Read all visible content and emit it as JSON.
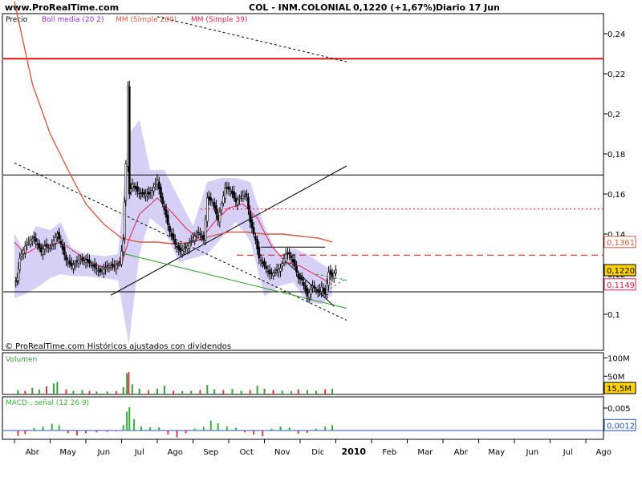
{
  "header": {
    "site": "www.ProRealTime.com",
    "title": "COL - INM.COLONIAL",
    "price_change": "0,1220 (+1,67%)",
    "period": "Diario",
    "date": "17 Jun"
  },
  "footer": {
    "source_note": "© ProRealTime.com  Históricos ajustados con dividendos"
  },
  "colors": {
    "price": "#000000",
    "bollinger": "#c8c0f4",
    "bollinger_label": "#9a2ee0",
    "ma200": "#d95a45",
    "ma39": "#e02050",
    "support_red": "#e01010",
    "volume": "#3a9c3a",
    "macd": "#38b038",
    "signal": "#2050d0",
    "axis_text": "#000000"
  },
  "chart_data": [
    {
      "type": "line",
      "panel": "price",
      "legend": [
        "Precio",
        "Boll media (20 2)",
        "MM (Simple 200)",
        "MM (Simple 39)"
      ],
      "months": [
        "Abr",
        "May",
        "Jun",
        "Jul",
        "Ago",
        "Sep",
        "Oct",
        "Nov",
        "Dic",
        "2010",
        "Feb",
        "Mar",
        "Abr",
        "May",
        "Jun",
        "Jul",
        "Ago"
      ],
      "y_ticks": [
        0.1,
        0.12,
        0.14,
        0.16,
        0.18,
        0.2,
        0.22,
        0.24
      ],
      "y_tick_labels": [
        "0,1",
        "0,12",
        "0,14",
        "0,16",
        "0,18",
        "0,2",
        "0,22",
        "0,24"
      ],
      "ylim": [
        0.082,
        0.25
      ],
      "price_labels": [
        {
          "text": "0,1361",
          "value": 0.1361,
          "color": "#d95a45"
        },
        {
          "text": "0,1220",
          "value": 0.122,
          "color": "#000000",
          "highlight": true
        },
        {
          "text": "0,1149",
          "value": 0.1149,
          "color": "#e02050"
        }
      ],
      "horizontal_levels": [
        {
          "value": 0.2275,
          "color": "#e01010",
          "style": "solid"
        },
        {
          "value": 0.1695,
          "color": "#000000",
          "style": "solid"
        },
        {
          "value": 0.1112,
          "color": "#000000",
          "style": "solid"
        },
        {
          "value": 0.1295,
          "color": "#e01010",
          "style": "dashed"
        },
        {
          "value": 0.1525,
          "color": "#e01010",
          "style": "dotted"
        }
      ],
      "close_points": [
        {
          "t": 0.0,
          "v": 0.115
        },
        {
          "t": 0.08,
          "v": 0.118
        },
        {
          "t": 0.15,
          "v": 0.128
        },
        {
          "t": 0.3,
          "v": 0.134
        },
        {
          "t": 0.45,
          "v": 0.137
        },
        {
          "t": 0.55,
          "v": 0.138
        },
        {
          "t": 0.75,
          "v": 0.131
        },
        {
          "t": 0.85,
          "v": 0.134
        },
        {
          "t": 1.0,
          "v": 0.133
        },
        {
          "t": 1.2,
          "v": 0.14
        },
        {
          "t": 1.3,
          "v": 0.135
        },
        {
          "t": 1.45,
          "v": 0.127
        },
        {
          "t": 1.6,
          "v": 0.124
        },
        {
          "t": 1.8,
          "v": 0.127
        },
        {
          "t": 2.0,
          "v": 0.127
        },
        {
          "t": 2.2,
          "v": 0.124
        },
        {
          "t": 2.4,
          "v": 0.121
        },
        {
          "t": 2.6,
          "v": 0.124
        },
        {
          "t": 2.8,
          "v": 0.124
        },
        {
          "t": 2.95,
          "v": 0.126
        },
        {
          "t": 3.05,
          "v": 0.137
        },
        {
          "t": 3.12,
          "v": 0.175
        },
        {
          "t": 3.18,
          "v": 0.214
        },
        {
          "t": 3.22,
          "v": 0.16
        },
        {
          "t": 3.3,
          "v": 0.165
        },
        {
          "t": 3.5,
          "v": 0.16
        },
        {
          "t": 3.8,
          "v": 0.16
        },
        {
          "t": 4.0,
          "v": 0.167
        },
        {
          "t": 4.1,
          "v": 0.158
        },
        {
          "t": 4.2,
          "v": 0.152
        },
        {
          "t": 4.35,
          "v": 0.141
        },
        {
          "t": 4.5,
          "v": 0.135
        },
        {
          "t": 4.65,
          "v": 0.131
        },
        {
          "t": 4.85,
          "v": 0.134
        },
        {
          "t": 5.0,
          "v": 0.138
        },
        {
          "t": 5.15,
          "v": 0.141
        },
        {
          "t": 5.3,
          "v": 0.137
        },
        {
          "t": 5.4,
          "v": 0.158
        },
        {
          "t": 5.55,
          "v": 0.156
        },
        {
          "t": 5.7,
          "v": 0.147
        },
        {
          "t": 5.9,
          "v": 0.163
        },
        {
          "t": 6.05,
          "v": 0.162
        },
        {
          "t": 6.2,
          "v": 0.156
        },
        {
          "t": 6.35,
          "v": 0.159
        },
        {
          "t": 6.5,
          "v": 0.159
        },
        {
          "t": 6.6,
          "v": 0.146
        },
        {
          "t": 6.75,
          "v": 0.137
        },
        {
          "t": 6.85,
          "v": 0.128
        },
        {
          "t": 7.0,
          "v": 0.124
        },
        {
          "t": 7.15,
          "v": 0.12
        },
        {
          "t": 7.3,
          "v": 0.121
        },
        {
          "t": 7.45,
          "v": 0.123
        },
        {
          "t": 7.6,
          "v": 0.13
        },
        {
          "t": 7.7,
          "v": 0.13
        },
        {
          "t": 7.85,
          "v": 0.124
        },
        {
          "t": 7.95,
          "v": 0.118
        },
        {
          "t": 8.05,
          "v": 0.117
        },
        {
          "t": 8.2,
          "v": 0.109
        },
        {
          "t": 8.35,
          "v": 0.114
        },
        {
          "t": 8.5,
          "v": 0.111
        },
        {
          "t": 8.6,
          "v": 0.1135
        },
        {
          "t": 8.7,
          "v": 0.11
        },
        {
          "t": 8.8,
          "v": 0.121
        },
        {
          "t": 8.9,
          "v": 0.119
        },
        {
          "t": 9.0,
          "v": 0.122
        }
      ],
      "ma200_points": [
        {
          "t": 0.0,
          "v": 0.256
        },
        {
          "t": 0.5,
          "v": 0.215
        },
        {
          "t": 1.0,
          "v": 0.19
        },
        {
          "t": 1.5,
          "v": 0.172
        },
        {
          "t": 2.0,
          "v": 0.155
        },
        {
          "t": 2.5,
          "v": 0.145
        },
        {
          "t": 3.0,
          "v": 0.138
        },
        {
          "t": 3.5,
          "v": 0.136
        },
        {
          "t": 4.0,
          "v": 0.136
        },
        {
          "t": 4.5,
          "v": 0.135
        },
        {
          "t": 5.0,
          "v": 0.136
        },
        {
          "t": 5.5,
          "v": 0.139
        },
        {
          "t": 6.0,
          "v": 0.141
        },
        {
          "t": 6.5,
          "v": 0.141
        },
        {
          "t": 7.0,
          "v": 0.14
        },
        {
          "t": 7.5,
          "v": 0.14
        },
        {
          "t": 8.0,
          "v": 0.139
        },
        {
          "t": 8.5,
          "v": 0.138
        },
        {
          "t": 8.9,
          "v": 0.1361
        }
      ],
      "ma39_points": [
        {
          "t": 0.0,
          "v": 0.136
        },
        {
          "t": 0.3,
          "v": 0.13
        },
        {
          "t": 0.7,
          "v": 0.134
        },
        {
          "t": 1.0,
          "v": 0.134
        },
        {
          "t": 1.3,
          "v": 0.136
        },
        {
          "t": 1.7,
          "v": 0.131
        },
        {
          "t": 2.2,
          "v": 0.125
        },
        {
          "t": 2.7,
          "v": 0.123
        },
        {
          "t": 3.0,
          "v": 0.125
        },
        {
          "t": 3.2,
          "v": 0.137
        },
        {
          "t": 3.5,
          "v": 0.15
        },
        {
          "t": 4.0,
          "v": 0.158
        },
        {
          "t": 4.4,
          "v": 0.151
        },
        {
          "t": 4.8,
          "v": 0.143
        },
        {
          "t": 5.2,
          "v": 0.137
        },
        {
          "t": 5.6,
          "v": 0.146
        },
        {
          "t": 6.0,
          "v": 0.153
        },
        {
          "t": 6.4,
          "v": 0.155
        },
        {
          "t": 6.8,
          "v": 0.148
        },
        {
          "t": 7.2,
          "v": 0.134
        },
        {
          "t": 7.6,
          "v": 0.126
        },
        {
          "t": 8.0,
          "v": 0.124
        },
        {
          "t": 8.4,
          "v": 0.12
        },
        {
          "t": 8.9,
          "v": 0.1149
        }
      ],
      "bollinger_upper": [
        {
          "t": 0.0,
          "v": 0.14
        },
        {
          "t": 0.3,
          "v": 0.131
        },
        {
          "t": 0.6,
          "v": 0.144
        },
        {
          "t": 1.0,
          "v": 0.142
        },
        {
          "t": 1.3,
          "v": 0.146
        },
        {
          "t": 1.6,
          "v": 0.133
        },
        {
          "t": 2.0,
          "v": 0.13
        },
        {
          "t": 2.5,
          "v": 0.129
        },
        {
          "t": 2.9,
          "v": 0.13
        },
        {
          "t": 3.2,
          "v": 0.19
        },
        {
          "t": 3.5,
          "v": 0.197
        },
        {
          "t": 3.8,
          "v": 0.172
        },
        {
          "t": 4.2,
          "v": 0.172
        },
        {
          "t": 4.6,
          "v": 0.158
        },
        {
          "t": 5.0,
          "v": 0.144
        },
        {
          "t": 5.4,
          "v": 0.166
        },
        {
          "t": 5.8,
          "v": 0.168
        },
        {
          "t": 6.2,
          "v": 0.168
        },
        {
          "t": 6.6,
          "v": 0.166
        },
        {
          "t": 7.0,
          "v": 0.144
        },
        {
          "t": 7.4,
          "v": 0.129
        },
        {
          "t": 7.8,
          "v": 0.133
        },
        {
          "t": 8.2,
          "v": 0.13
        },
        {
          "t": 8.6,
          "v": 0.125
        },
        {
          "t": 8.9,
          "v": 0.122
        }
      ],
      "bollinger_lower": [
        {
          "t": 0.0,
          "v": 0.108
        },
        {
          "t": 0.3,
          "v": 0.11
        },
        {
          "t": 0.6,
          "v": 0.113
        },
        {
          "t": 1.0,
          "v": 0.118
        },
        {
          "t": 1.3,
          "v": 0.12
        },
        {
          "t": 1.6,
          "v": 0.119
        },
        {
          "t": 2.0,
          "v": 0.119
        },
        {
          "t": 2.5,
          "v": 0.118
        },
        {
          "t": 2.9,
          "v": 0.117
        },
        {
          "t": 3.2,
          "v": 0.085
        },
        {
          "t": 3.5,
          "v": 0.13
        },
        {
          "t": 3.8,
          "v": 0.148
        },
        {
          "t": 4.2,
          "v": 0.142
        },
        {
          "t": 4.6,
          "v": 0.126
        },
        {
          "t": 5.0,
          "v": 0.128
        },
        {
          "t": 5.4,
          "v": 0.13
        },
        {
          "t": 5.8,
          "v": 0.138
        },
        {
          "t": 6.2,
          "v": 0.146
        },
        {
          "t": 6.6,
          "v": 0.137
        },
        {
          "t": 7.0,
          "v": 0.109
        },
        {
          "t": 7.4,
          "v": 0.114
        },
        {
          "t": 7.8,
          "v": 0.116
        },
        {
          "t": 8.2,
          "v": 0.106
        },
        {
          "t": 8.6,
          "v": 0.105
        },
        {
          "t": 8.9,
          "v": 0.11
        }
      ],
      "trend_lines": [
        {
          "t1": 0.0,
          "v1": 0.1755,
          "t2": 9.3,
          "v2": 0.097,
          "color": "#000000",
          "style": "dotted"
        },
        {
          "t1": 4.0,
          "v1": 0.2485,
          "t2": 9.3,
          "v2": 0.226,
          "color": "#000000",
          "style": "dotted"
        },
        {
          "t1": 2.7,
          "v1": 0.1095,
          "t2": 9.3,
          "v2": 0.174,
          "color": "#000000",
          "style": "solid"
        },
        {
          "t1": 3.0,
          "v1": 0.1305,
          "t2": 9.3,
          "v2": 0.103,
          "color": "#20a020",
          "style": "solid"
        },
        {
          "t1": 6.9,
          "v1": 0.1335,
          "t2": 8.7,
          "v2": 0.1335,
          "color": "#000000",
          "style": "solid"
        },
        {
          "t1": 7.5,
          "v1": 0.128,
          "t2": 8.95,
          "v2": 0.104,
          "color": "#000000",
          "style": "solid"
        },
        {
          "t1": 8.45,
          "v1": 0.12,
          "t2": 9.3,
          "v2": 0.117,
          "color": "#20a020",
          "style": "dotted"
        },
        {
          "t1": 8.5,
          "v1": 0.109,
          "t2": 9.3,
          "v2": 0.118,
          "color": "#20a020",
          "style": "dotted"
        }
      ]
    },
    {
      "type": "bar",
      "panel": "volume",
      "title": "Volumen",
      "y_ticks": [
        50,
        100
      ],
      "y_tick_labels": [
        "50M",
        "100M"
      ],
      "ylim": [
        0,
        110
      ],
      "last_label": "15,5M",
      "last_value": 15.5,
      "bars": [
        {
          "t": 0.1,
          "v": 12
        },
        {
          "t": 0.3,
          "v": 10
        },
        {
          "t": 0.5,
          "v": 18
        },
        {
          "t": 0.7,
          "v": 14
        },
        {
          "t": 0.9,
          "v": 22
        },
        {
          "t": 1.1,
          "v": 30
        },
        {
          "t": 1.2,
          "v": 34
        },
        {
          "t": 1.45,
          "v": 14
        },
        {
          "t": 1.65,
          "v": 10
        },
        {
          "t": 1.9,
          "v": 12
        },
        {
          "t": 2.1,
          "v": 9
        },
        {
          "t": 2.3,
          "v": 8
        },
        {
          "t": 2.6,
          "v": 8
        },
        {
          "t": 2.85,
          "v": 9
        },
        {
          "t": 3.05,
          "v": 20
        },
        {
          "t": 3.15,
          "v": 58
        },
        {
          "t": 3.2,
          "v": 62
        },
        {
          "t": 3.3,
          "v": 28
        },
        {
          "t": 3.5,
          "v": 16
        },
        {
          "t": 3.75,
          "v": 12
        },
        {
          "t": 4.0,
          "v": 16
        },
        {
          "t": 4.2,
          "v": 24
        },
        {
          "t": 4.45,
          "v": 10
        },
        {
          "t": 4.7,
          "v": 9
        },
        {
          "t": 4.95,
          "v": 10
        },
        {
          "t": 5.2,
          "v": 12
        },
        {
          "t": 5.4,
          "v": 26
        },
        {
          "t": 5.6,
          "v": 14
        },
        {
          "t": 5.85,
          "v": 12
        },
        {
          "t": 6.1,
          "v": 15
        },
        {
          "t": 6.35,
          "v": 10
        },
        {
          "t": 6.6,
          "v": 12
        },
        {
          "t": 6.8,
          "v": 24
        },
        {
          "t": 7.0,
          "v": 16
        },
        {
          "t": 7.25,
          "v": 12
        },
        {
          "t": 7.5,
          "v": 10
        },
        {
          "t": 7.75,
          "v": 9
        },
        {
          "t": 7.95,
          "v": 14
        },
        {
          "t": 8.2,
          "v": 12
        },
        {
          "t": 8.45,
          "v": 10
        },
        {
          "t": 8.7,
          "v": 14
        },
        {
          "t": 8.9,
          "v": 15.5
        }
      ]
    },
    {
      "type": "bar",
      "panel": "macd",
      "title": "MACD-, señal (12 26 9)",
      "y_ticks": [
        0.005
      ],
      "y_tick_labels": [
        "0,005"
      ],
      "ylim": [
        -0.003,
        0.0075
      ],
      "last_label": "0,0012",
      "last_value": 0.0012,
      "bars": [
        {
          "t": 0.1,
          "v": -0.0012
        },
        {
          "t": 0.3,
          "v": -0.0008
        },
        {
          "t": 0.55,
          "v": 0.0006
        },
        {
          "t": 0.8,
          "v": 0.0009
        },
        {
          "t": 1.05,
          "v": 0.0015
        },
        {
          "t": 1.25,
          "v": 0.0012
        },
        {
          "t": 1.5,
          "v": -0.0006
        },
        {
          "t": 1.75,
          "v": -0.0011
        },
        {
          "t": 2.0,
          "v": -0.0006
        },
        {
          "t": 2.3,
          "v": -0.0004
        },
        {
          "t": 2.6,
          "v": -0.0003
        },
        {
          "t": 2.85,
          "v": -0.0002
        },
        {
          "t": 3.05,
          "v": 0.0012
        },
        {
          "t": 3.15,
          "v": 0.0042
        },
        {
          "t": 3.22,
          "v": 0.0052
        },
        {
          "t": 3.35,
          "v": 0.0025
        },
        {
          "t": 3.55,
          "v": 0.0009
        },
        {
          "t": 3.8,
          "v": 0.0007
        },
        {
          "t": 4.05,
          "v": 0.0007
        },
        {
          "t": 4.3,
          "v": -0.0009
        },
        {
          "t": 4.55,
          "v": -0.0015
        },
        {
          "t": 4.8,
          "v": -0.0006
        },
        {
          "t": 5.05,
          "v": 0.0004
        },
        {
          "t": 5.3,
          "v": 0.0008
        },
        {
          "t": 5.5,
          "v": 0.0022
        },
        {
          "t": 5.7,
          "v": 0.0016
        },
        {
          "t": 5.95,
          "v": 0.0009
        },
        {
          "t": 6.2,
          "v": 0.0006
        },
        {
          "t": 6.45,
          "v": -0.0004
        },
        {
          "t": 6.7,
          "v": -0.0009
        },
        {
          "t": 6.95,
          "v": -0.0013
        },
        {
          "t": 7.2,
          "v": 0.0004
        },
        {
          "t": 7.45,
          "v": 0.0009
        },
        {
          "t": 7.7,
          "v": 0.0007
        },
        {
          "t": 7.95,
          "v": -0.0007
        },
        {
          "t": 8.2,
          "v": -0.0005
        },
        {
          "t": 8.45,
          "v": 0.0004
        },
        {
          "t": 8.7,
          "v": 0.0009
        },
        {
          "t": 8.9,
          "v": 0.0012
        }
      ]
    }
  ]
}
